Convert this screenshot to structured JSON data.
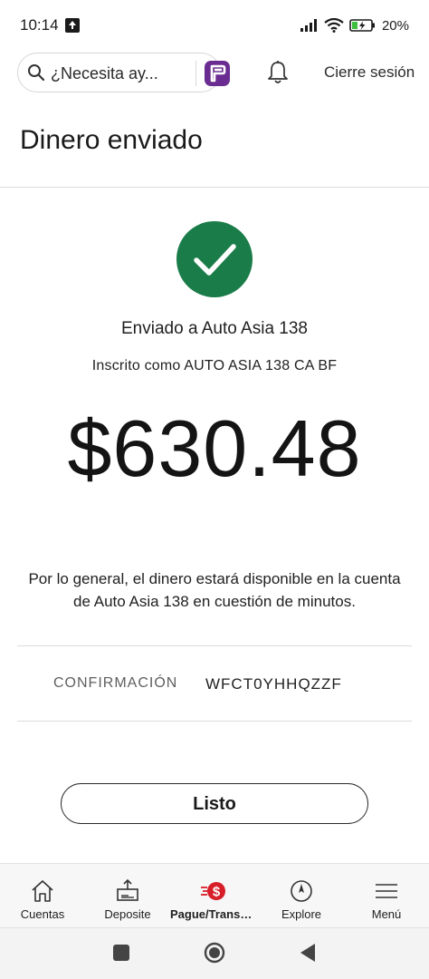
{
  "status_bar": {
    "time": "10:14",
    "battery": "20%"
  },
  "header": {
    "search_placeholder": "¿Necesita ay...",
    "signout_label": "Cierre sesión"
  },
  "page": {
    "title": "Dinero enviado"
  },
  "confirmation": {
    "sent_to": "Enviado a Auto Asia 138",
    "enrolled_as": "Inscrito como AUTO ASIA 138 CA BF",
    "amount": "$630.48",
    "availability_note": "Por lo general, el dinero estará disponible en la cuenta de Auto Asia 138 en cuestión de minutos.",
    "confirmation_label": "CONFIRMACIÓN",
    "confirmation_number": "WFCT0YHHQZZF",
    "done_label": "Listo"
  },
  "colors": {
    "success_green": "#1a7d49",
    "brand_red": "#d71e28",
    "fargo_purple": "#6a2c91"
  },
  "bottom_nav": {
    "items": [
      {
        "label": "Cuentas",
        "icon": "home-icon"
      },
      {
        "label": "Deposite",
        "icon": "deposit-icon"
      },
      {
        "label": "Pague/Transfi...",
        "icon": "pay-transfer-icon",
        "active": true
      },
      {
        "label": "Explore",
        "icon": "compass-icon"
      },
      {
        "label": "Menú",
        "icon": "hamburger-menu-icon"
      }
    ]
  }
}
